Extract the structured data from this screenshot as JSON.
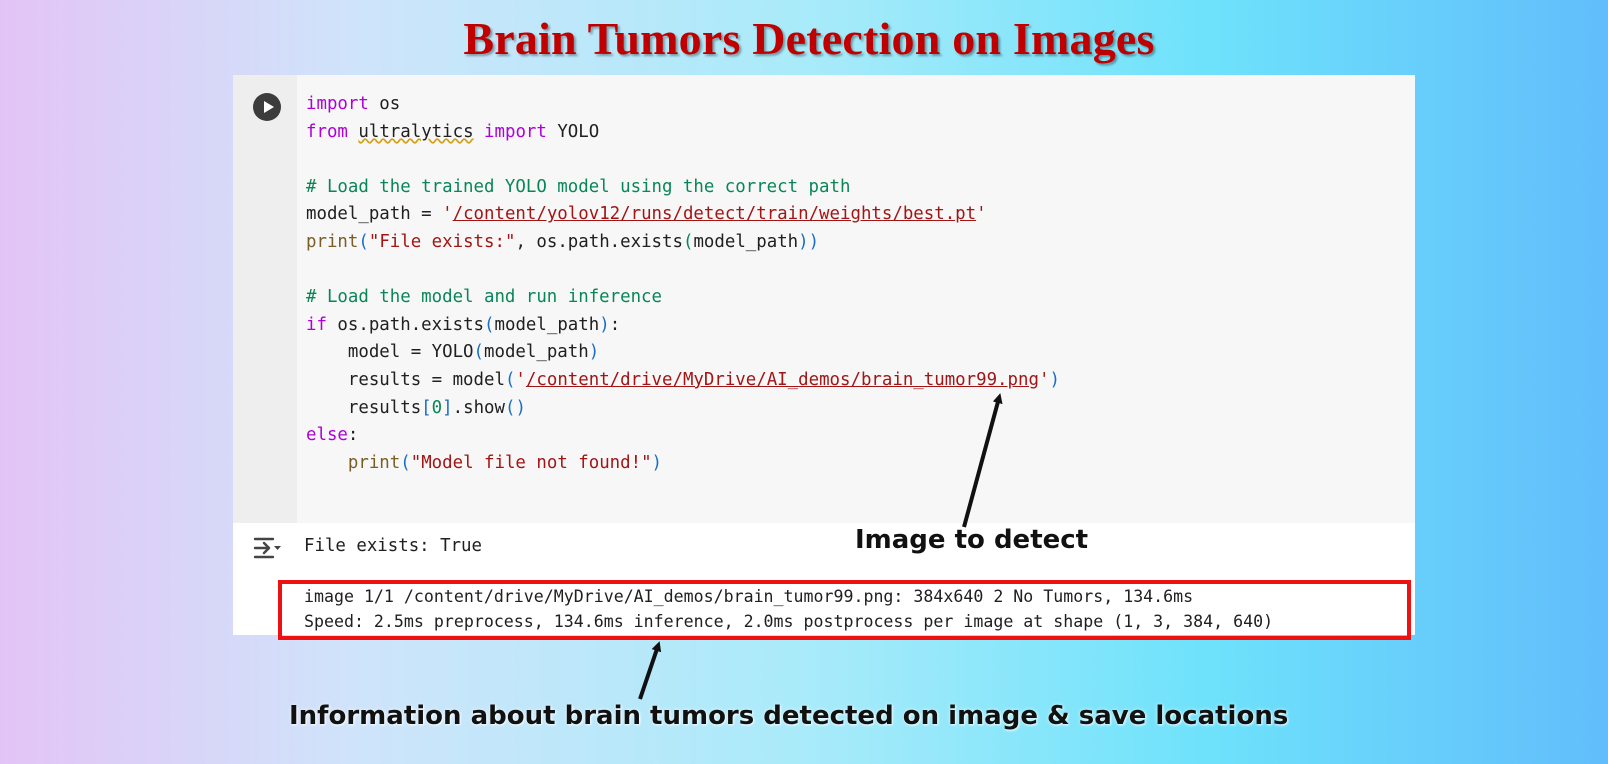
{
  "title": "Brain Tumors Detection on Images",
  "cell": {
    "run_icon": "play-circle-icon",
    "code": {
      "l1_kw": "import",
      "l1_rest": " os",
      "l2_kw1": "from",
      "l2_mod": "ultralytics",
      "l2_kw2": "import",
      "l2_rest": " YOLO",
      "l4_comment": "# Load the trained YOLO model using the correct path",
      "l5_pre": "model_path = ",
      "l5_q1": "'",
      "l5_str": "/content/yolov12/runs/detect/train/weights/best.pt",
      "l5_q2": "'",
      "l6_fn": "print",
      "l6_p1": "(",
      "l6_str": "\"File exists:\"",
      "l6_mid": ", os.path.exists",
      "l6_p2": "(",
      "l6_arg": "model_path",
      "l6_p3": "))",
      "l8_comment": "# Load the model and run inference",
      "l9_kw": "if",
      "l9_pre": " os.path.exists",
      "l9_p1": "(",
      "l9_arg": "model_path",
      "l9_p2": ")",
      "l9_end": ":",
      "l10_pre": "    model = YOLO",
      "l10_p1": "(",
      "l10_arg": "model_path",
      "l10_p2": ")",
      "l11_pre": "    results = model",
      "l11_p1": "(",
      "l11_q1": "'",
      "l11_str": "/content/drive/MyDrive/AI_demos/brain_tumor99.png",
      "l11_q2": "'",
      "l11_p2": ")",
      "l12_pre": "    results",
      "l12_b1": "[",
      "l12_num": "0",
      "l12_b2": "]",
      "l12_mid": ".show",
      "l12_p": "()",
      "l13_kw": "else",
      "l13_end": ":",
      "l14_pre": "    ",
      "l14_fn": "print",
      "l14_p1": "(",
      "l14_str": "\"Model file not found!\"",
      "l14_p2": ")"
    }
  },
  "output": {
    "icon": "output-toggle-icon",
    "line1": "File exists: True",
    "line2": "image 1/1 /content/drive/MyDrive/AI_demos/brain_tumor99.png: 384x640 2 No Tumors, 134.6ms",
    "line3": "Speed: 2.5ms preprocess, 134.6ms inference, 2.0ms postprocess per image at shape (1, 3, 384, 640)"
  },
  "annotations": {
    "image_to_detect": "Image to detect",
    "info": "Information about brain tumors detected on image & save locations"
  },
  "colors": {
    "title": "#c00000",
    "highlight_box": "#ee1111",
    "keyword": "#af00db",
    "comment": "#098658",
    "string": "#a31515"
  }
}
